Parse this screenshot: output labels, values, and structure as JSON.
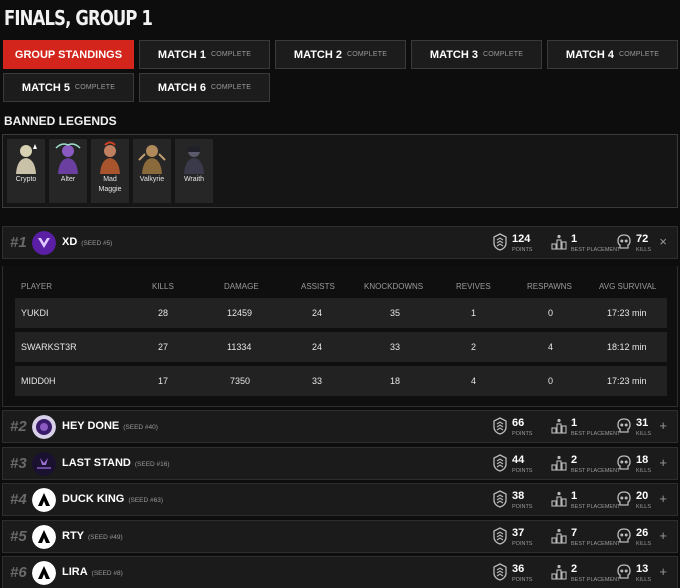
{
  "page_title": "FINALS, GROUP 1",
  "tabs": [
    {
      "label": "GROUP STANDINGS",
      "status": "",
      "active": true
    },
    {
      "label": "MATCH 1",
      "status": "COMPLETE",
      "active": false
    },
    {
      "label": "MATCH 2",
      "status": "COMPLETE",
      "active": false
    },
    {
      "label": "MATCH 3",
      "status": "COMPLETE",
      "active": false
    },
    {
      "label": "MATCH 4",
      "status": "COMPLETE",
      "active": false
    },
    {
      "label": "MATCH 5",
      "status": "COMPLETE",
      "active": false
    },
    {
      "label": "MATCH 6",
      "status": "COMPLETE",
      "active": false
    }
  ],
  "banned": {
    "title": "BANNED LEGENDS",
    "legends": [
      {
        "name": "Crypto",
        "color": "#c9c2a8"
      },
      {
        "name": "Alter",
        "color": "#6a3fa0"
      },
      {
        "name": "Mad Maggie",
        "color": "#a8542c"
      },
      {
        "name": "Valkyrie",
        "color": "#8a6a3a"
      },
      {
        "name": "Wraith",
        "color": "#3a3a4a"
      }
    ]
  },
  "stat_labels": {
    "points": "POINTS",
    "best": "BEST PLACEMENT",
    "kills": "KILLS"
  },
  "teams": [
    {
      "rank": "#1",
      "name": "XD",
      "seed": "(SEED #5)",
      "points": "124",
      "best": "1",
      "kills": "72",
      "toggle": "×",
      "logo_color": "#6b2fb5"
    },
    {
      "rank": "#2",
      "name": "HEY DONE",
      "seed": "(SEED #40)",
      "points": "66",
      "best": "1",
      "kills": "31",
      "toggle": "+",
      "logo_color": "#4a2a7a"
    },
    {
      "rank": "#3",
      "name": "LAST STAND",
      "seed": "(SEED #16)",
      "points": "44",
      "best": "2",
      "kills": "18",
      "toggle": "+",
      "logo_color": "#2a1a4a"
    },
    {
      "rank": "#4",
      "name": "DUCK KING",
      "seed": "(SEED #63)",
      "points": "38",
      "best": "1",
      "kills": "20",
      "toggle": "+",
      "logo_color": "#000000"
    },
    {
      "rank": "#5",
      "name": "RTY",
      "seed": "(SEED #49)",
      "points": "37",
      "best": "7",
      "kills": "26",
      "toggle": "+",
      "logo_color": "#000000"
    },
    {
      "rank": "#6",
      "name": "LIRA",
      "seed": "(SEED #8)",
      "points": "36",
      "best": "2",
      "kills": "13",
      "toggle": "+",
      "logo_color": "#000000"
    }
  ],
  "player_table": {
    "headers": [
      "PLAYER",
      "KILLS",
      "DAMAGE",
      "ASSISTS",
      "KNOCKDOWNS",
      "REVIVES",
      "RESPAWNS",
      "AVG SURVIVAL"
    ],
    "rows": [
      [
        "YUKDI",
        "28",
        "12459",
        "24",
        "35",
        "1",
        "0",
        "17:23 min"
      ],
      [
        "SWARKST3R",
        "27",
        "11334",
        "24",
        "33",
        "2",
        "4",
        "18:12 min"
      ],
      [
        "MIDD0H",
        "17",
        "7350",
        "33",
        "18",
        "4",
        "0",
        "17:23 min"
      ]
    ]
  }
}
